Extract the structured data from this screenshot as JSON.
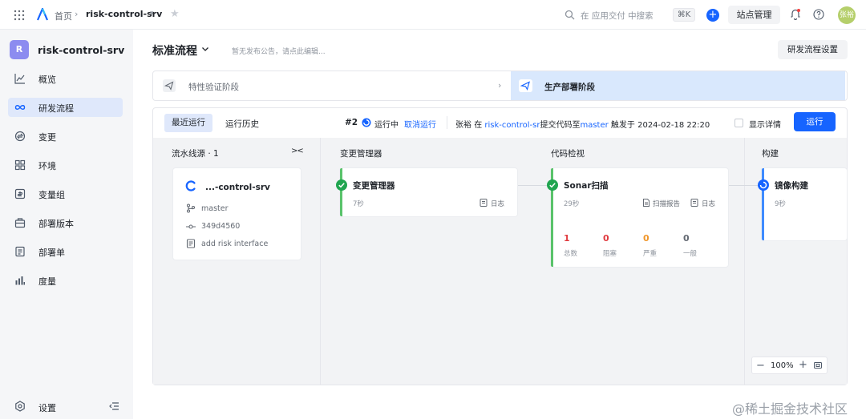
{
  "topbar": {
    "home": "首页",
    "project": "risk-control-srv",
    "search_placeholder": "在 应用交付 中搜索",
    "shortcut": "⌘K",
    "site_manage": "站点管理",
    "avatar_text": "张裕"
  },
  "sidebar": {
    "project_badge": "R",
    "project_name": "risk-control-srv",
    "items": [
      {
        "label": "概览",
        "icon": "chart-line-icon"
      },
      {
        "label": "研发流程",
        "icon": "infinity-icon",
        "active": true
      },
      {
        "label": "变更",
        "icon": "change-icon"
      },
      {
        "label": "环境",
        "icon": "grid-icon"
      },
      {
        "label": "变量组",
        "icon": "variable-icon"
      },
      {
        "label": "部署版本",
        "icon": "package-icon"
      },
      {
        "label": "部署单",
        "icon": "document-icon"
      },
      {
        "label": "度量",
        "icon": "bar-chart-icon"
      }
    ],
    "settings": "设置"
  },
  "main": {
    "title": "标准流程",
    "notice": "暂无发布公告，请点此编辑...",
    "flow_settings": "研发流程设置",
    "stages": [
      {
        "label": "特性验证阶段",
        "active": false
      },
      {
        "label": "生产部署阶段",
        "active": true
      }
    ],
    "tabs": {
      "recent": "最近运行",
      "history": "运行历史"
    },
    "run": {
      "number": "#2",
      "status": "运行中",
      "cancel": "取消运行",
      "user": "张裕",
      "at": "在",
      "repo": "risk-control-sr",
      "action": "提交代码至",
      "branch": "master",
      "trigger": "触发于 2024-02-18 22:20",
      "show_detail": "显示详情",
      "run_button": "运行"
    },
    "columns": {
      "source": "流水线源 · 1",
      "change_mgr": "变更管理器",
      "code_check": "代码检视",
      "build": "构建"
    },
    "source_card": {
      "name": "...-control-srv",
      "branch": "master",
      "commit": "349d4560",
      "message": "add risk interface"
    },
    "jobs": {
      "change": {
        "name": "变更管理器",
        "time": "7秒",
        "log": "日志",
        "status": "success"
      },
      "sonar": {
        "name": "Sonar扫描",
        "time": "29秒",
        "report": "扫描报告",
        "log": "日志",
        "status": "success",
        "metrics": [
          {
            "value": "1",
            "label": "总数",
            "color": "#e03a3e"
          },
          {
            "value": "0",
            "label": "阻塞",
            "color": "#e03a3e"
          },
          {
            "value": "0",
            "label": "严重",
            "color": "#f0962a"
          },
          {
            "value": "0",
            "label": "一般",
            "color": "#646a73"
          }
        ]
      },
      "image": {
        "name": "镜像构建",
        "time": "9秒",
        "status": "running"
      }
    },
    "zoom": "100%"
  },
  "watermark": "@稀土掘金技术社区",
  "colors": {
    "primary": "#1664ff",
    "success": "#5ac36b",
    "active_bg": "#dfe8fb"
  }
}
